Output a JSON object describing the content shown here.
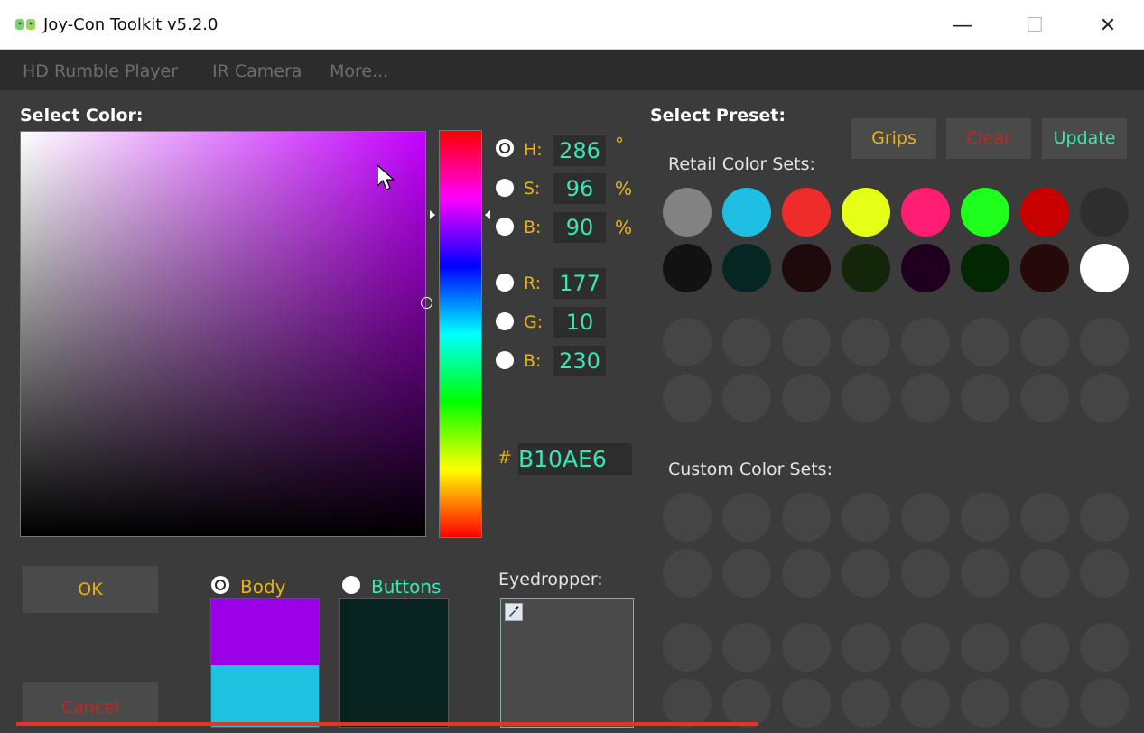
{
  "window": {
    "title": "Joy-Con Toolkit v5.2.0",
    "minimize": "—",
    "maximize": "☐",
    "close": "✕"
  },
  "menu": [
    "HD Rumble Player",
    "IR Camera",
    "More..."
  ],
  "picker": {
    "select_color_label": "Select Color:",
    "hue": 286,
    "fields": {
      "h": {
        "label": "H:",
        "value": "286",
        "unit": "°"
      },
      "s": {
        "label": "S:",
        "value": "96",
        "unit": "%"
      },
      "b": {
        "label": "B:",
        "value": "90",
        "unit": "%"
      },
      "r": {
        "label": "R:",
        "value": "177"
      },
      "g": {
        "label": "G:",
        "value": "10"
      },
      "bl": {
        "label": "B:",
        "value": "230"
      }
    },
    "hex_symbol": "#",
    "hex_value": "B10AE6"
  },
  "buttons": {
    "ok": "OK",
    "cancel": "Cancel",
    "grips": "Grips",
    "clear": "Clear",
    "update": "Update"
  },
  "targets": {
    "body_label": "Body",
    "buttons_label": "Buttons",
    "body_color": "#9a00e6",
    "body_second_color": "#1ec2e0",
    "buttons_color": "#082220"
  },
  "eyedropper": {
    "label": "Eyedropper:",
    "icon": "eyedropper-icon"
  },
  "presets": {
    "select_label": "Select Preset:",
    "retail_label": "Retail Color Sets:",
    "custom_label": "Custom Color Sets:",
    "retail_row1": [
      "#828282",
      "#1ebfe3",
      "#ee2d2b",
      "#e6ff17",
      "#ff1e72",
      "#1eff1e",
      "#c80000",
      "#2e2e2e"
    ],
    "retail_row2": [
      "#121212",
      "#062624",
      "#1e0a0a",
      "#14260a",
      "#1e001e",
      "#032603",
      "#260a0a",
      "#ffffff"
    ]
  }
}
